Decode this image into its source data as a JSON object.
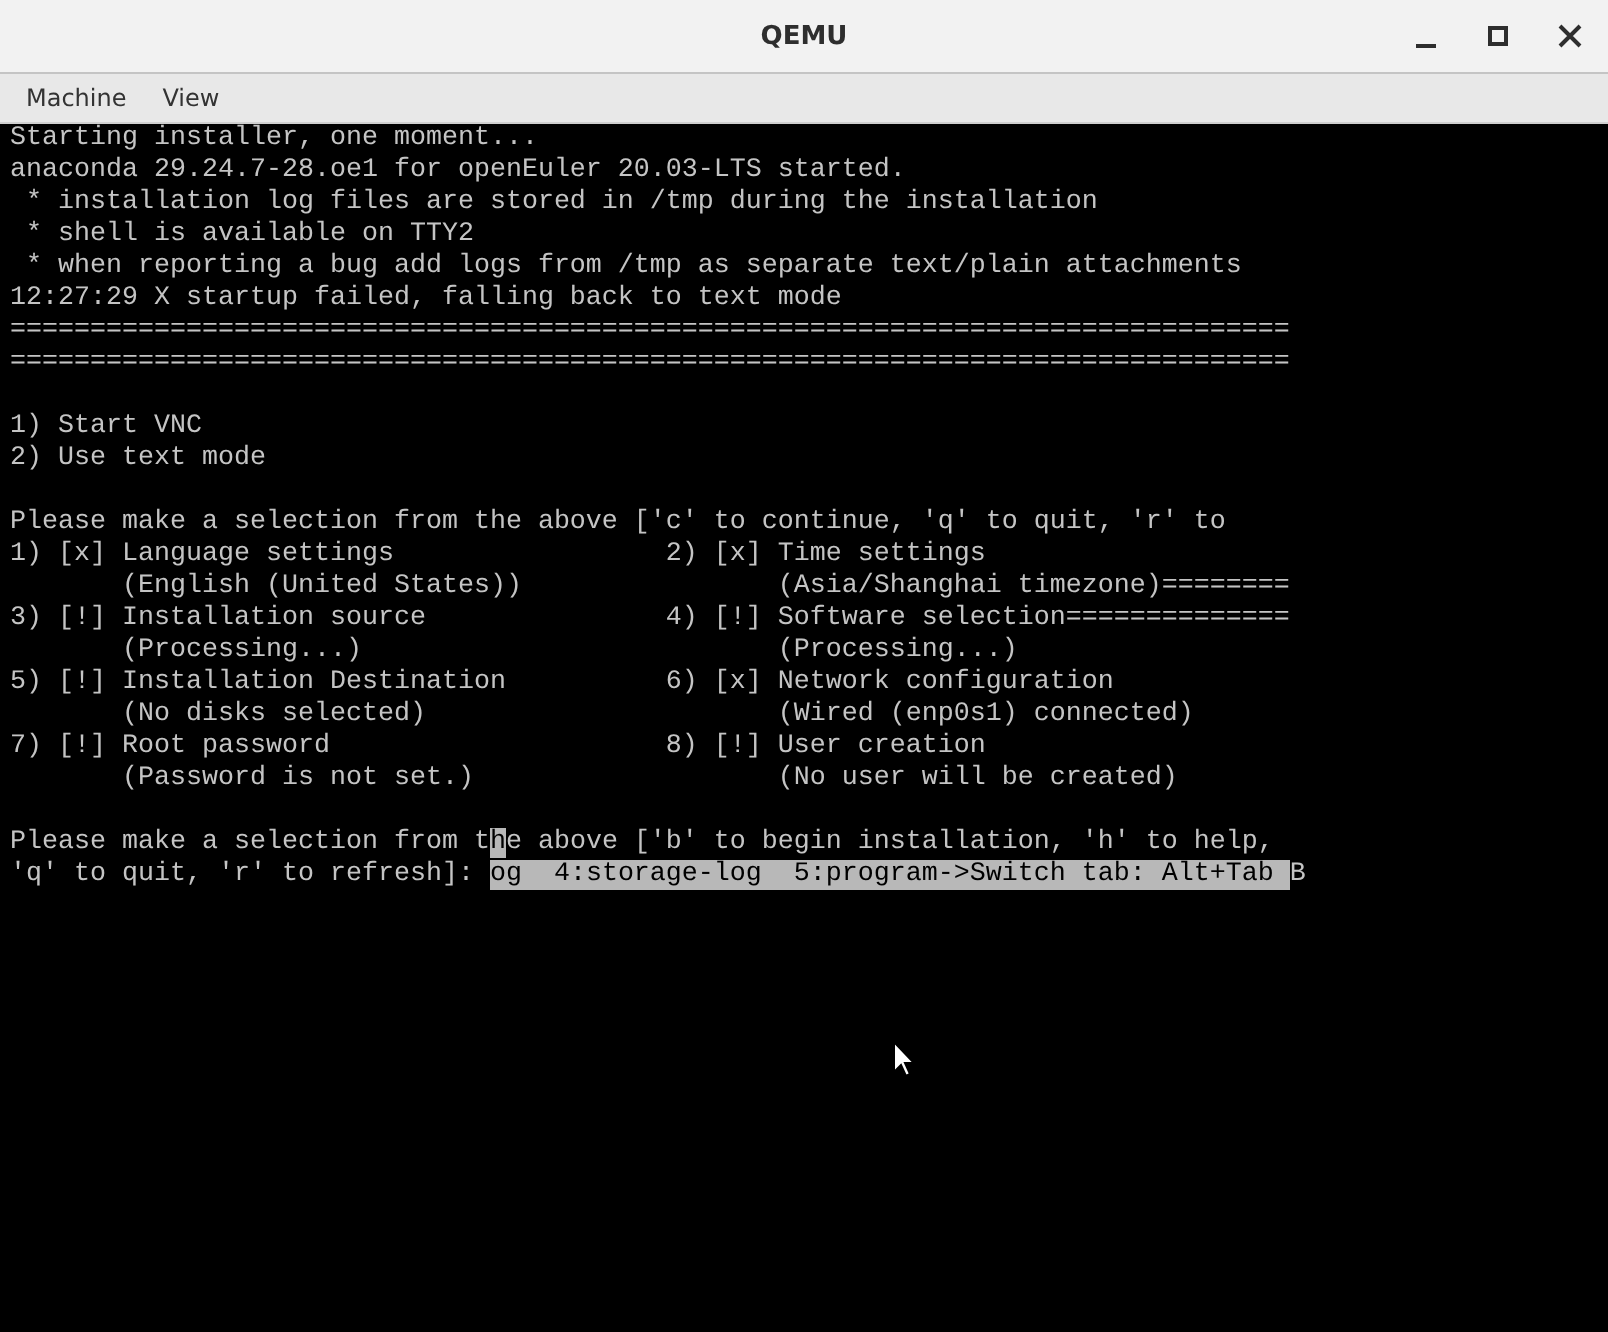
{
  "window": {
    "title": "QEMU"
  },
  "menu": [
    "Machine",
    "View"
  ],
  "terminal": [
    [
      {
        "kind": "text",
        "segments": [
          {
            "text": "Starting installer, one moment...",
            "highlighted": false
          }
        ]
      },
      {
        "kind": "text",
        "segments": [
          {
            "text": "anaconda 29.24.7-28.oe1 for openEuler 20.03-LTS started.",
            "highlighted": false
          }
        ]
      },
      {
        "kind": "text",
        "segments": [
          {
            "text": " * installation log files are stored in /tmp during the installation",
            "highlighted": false
          }
        ]
      },
      {
        "kind": "text",
        "segments": [
          {
            "text": " * shell is available on TTY2",
            "highlighted": false
          }
        ]
      },
      {
        "kind": "text",
        "segments": [
          {
            "text": " * when reporting a bug add logs from /tmp as separate text/plain attachments",
            "highlighted": false
          }
        ]
      },
      {
        "kind": "text",
        "segments": [
          {
            "text": "12:27:29 X startup failed, falling back to text mode",
            "highlighted": false
          }
        ]
      },
      {
        "kind": "text",
        "segments": [
          {
            "text": "================================================================================",
            "highlighted": false
          }
        ]
      },
      {
        "kind": "text",
        "segments": [
          {
            "text": "================================================================================",
            "highlighted": false
          }
        ]
      }
    ],
    [
      {
        "kind": "text",
        "segments": [
          {
            "text": "1) Start VNC",
            "highlighted": false
          }
        ]
      },
      {
        "kind": "text",
        "segments": [
          {
            "text": "2) Use text mode",
            "highlighted": false
          }
        ]
      }
    ],
    [
      {
        "kind": "text",
        "segments": [
          {
            "text": "Please make a selection from the above ['c' to continue, 'q' to quit, 'r' to",
            "highlighted": false
          }
        ]
      },
      {
        "kind": "columns",
        "left": "1) [x] Language settings",
        "right": "2) [x] Time settings"
      },
      {
        "kind": "columns",
        "left": "       (English (United States))",
        "right": "       (Asia/Shanghai timezone)========"
      },
      {
        "kind": "columns",
        "left": "3) [!] Installation source",
        "right": "4) [!] Software selection=============="
      },
      {
        "kind": "columns",
        "left": "       (Processing...)",
        "right": "       (Processing...)"
      },
      {
        "kind": "columns",
        "left": "5) [!] Installation Destination",
        "right": "6) [x] Network configuration"
      },
      {
        "kind": "columns",
        "left": "       (No disks selected)",
        "right": "       (Wired (enp0s1) connected)"
      },
      {
        "kind": "columns",
        "left": "7) [!] Root password",
        "right": "8) [!] User creation"
      },
      {
        "kind": "columns",
        "left": "       (Password is not set.)",
        "right": "       (No user will be created)"
      }
    ],
    [
      {
        "kind": "text",
        "segments": [
          {
            "text": "Please make a selection from t",
            "highlighted": false
          },
          {
            "text": "h",
            "highlighted": true
          },
          {
            "text": "e above ['b' to begin installation, 'h' to help,",
            "highlighted": false
          }
        ]
      },
      {
        "kind": "text",
        "segments": [
          {
            "text": "'q' to quit, 'r' to refresh]: ",
            "highlighted": false
          },
          {
            "text": "og  4:storage-log  5:program->Switch tab: Alt+Tab ",
            "highlighted": true
          },
          {
            "text": "B",
            "highlighted": false
          }
        ]
      }
    ]
  ]
}
